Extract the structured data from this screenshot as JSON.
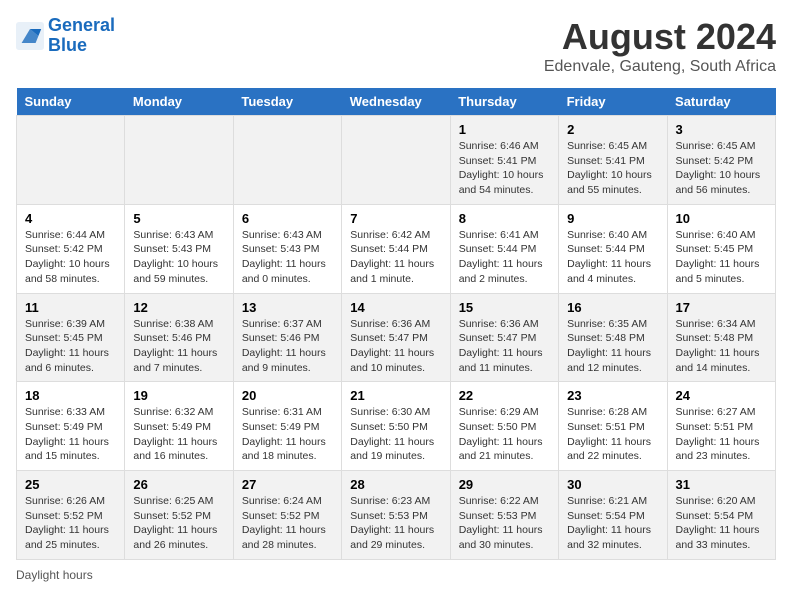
{
  "header": {
    "logo_line1": "General",
    "logo_line2": "Blue",
    "title": "August 2024",
    "subtitle": "Edenvale, Gauteng, South Africa"
  },
  "weekdays": [
    "Sunday",
    "Monday",
    "Tuesday",
    "Wednesday",
    "Thursday",
    "Friday",
    "Saturday"
  ],
  "weeks": [
    [
      {
        "day": "",
        "info": ""
      },
      {
        "day": "",
        "info": ""
      },
      {
        "day": "",
        "info": ""
      },
      {
        "day": "",
        "info": ""
      },
      {
        "day": "1",
        "info": "Sunrise: 6:46 AM\nSunset: 5:41 PM\nDaylight: 10 hours and 54 minutes."
      },
      {
        "day": "2",
        "info": "Sunrise: 6:45 AM\nSunset: 5:41 PM\nDaylight: 10 hours and 55 minutes."
      },
      {
        "day": "3",
        "info": "Sunrise: 6:45 AM\nSunset: 5:42 PM\nDaylight: 10 hours and 56 minutes."
      }
    ],
    [
      {
        "day": "4",
        "info": "Sunrise: 6:44 AM\nSunset: 5:42 PM\nDaylight: 10 hours and 58 minutes."
      },
      {
        "day": "5",
        "info": "Sunrise: 6:43 AM\nSunset: 5:43 PM\nDaylight: 10 hours and 59 minutes."
      },
      {
        "day": "6",
        "info": "Sunrise: 6:43 AM\nSunset: 5:43 PM\nDaylight: 11 hours and 0 minutes."
      },
      {
        "day": "7",
        "info": "Sunrise: 6:42 AM\nSunset: 5:44 PM\nDaylight: 11 hours and 1 minute."
      },
      {
        "day": "8",
        "info": "Sunrise: 6:41 AM\nSunset: 5:44 PM\nDaylight: 11 hours and 2 minutes."
      },
      {
        "day": "9",
        "info": "Sunrise: 6:40 AM\nSunset: 5:44 PM\nDaylight: 11 hours and 4 minutes."
      },
      {
        "day": "10",
        "info": "Sunrise: 6:40 AM\nSunset: 5:45 PM\nDaylight: 11 hours and 5 minutes."
      }
    ],
    [
      {
        "day": "11",
        "info": "Sunrise: 6:39 AM\nSunset: 5:45 PM\nDaylight: 11 hours and 6 minutes."
      },
      {
        "day": "12",
        "info": "Sunrise: 6:38 AM\nSunset: 5:46 PM\nDaylight: 11 hours and 7 minutes."
      },
      {
        "day": "13",
        "info": "Sunrise: 6:37 AM\nSunset: 5:46 PM\nDaylight: 11 hours and 9 minutes."
      },
      {
        "day": "14",
        "info": "Sunrise: 6:36 AM\nSunset: 5:47 PM\nDaylight: 11 hours and 10 minutes."
      },
      {
        "day": "15",
        "info": "Sunrise: 6:36 AM\nSunset: 5:47 PM\nDaylight: 11 hours and 11 minutes."
      },
      {
        "day": "16",
        "info": "Sunrise: 6:35 AM\nSunset: 5:48 PM\nDaylight: 11 hours and 12 minutes."
      },
      {
        "day": "17",
        "info": "Sunrise: 6:34 AM\nSunset: 5:48 PM\nDaylight: 11 hours and 14 minutes."
      }
    ],
    [
      {
        "day": "18",
        "info": "Sunrise: 6:33 AM\nSunset: 5:49 PM\nDaylight: 11 hours and 15 minutes."
      },
      {
        "day": "19",
        "info": "Sunrise: 6:32 AM\nSunset: 5:49 PM\nDaylight: 11 hours and 16 minutes."
      },
      {
        "day": "20",
        "info": "Sunrise: 6:31 AM\nSunset: 5:49 PM\nDaylight: 11 hours and 18 minutes."
      },
      {
        "day": "21",
        "info": "Sunrise: 6:30 AM\nSunset: 5:50 PM\nDaylight: 11 hours and 19 minutes."
      },
      {
        "day": "22",
        "info": "Sunrise: 6:29 AM\nSunset: 5:50 PM\nDaylight: 11 hours and 21 minutes."
      },
      {
        "day": "23",
        "info": "Sunrise: 6:28 AM\nSunset: 5:51 PM\nDaylight: 11 hours and 22 minutes."
      },
      {
        "day": "24",
        "info": "Sunrise: 6:27 AM\nSunset: 5:51 PM\nDaylight: 11 hours and 23 minutes."
      }
    ],
    [
      {
        "day": "25",
        "info": "Sunrise: 6:26 AM\nSunset: 5:52 PM\nDaylight: 11 hours and 25 minutes."
      },
      {
        "day": "26",
        "info": "Sunrise: 6:25 AM\nSunset: 5:52 PM\nDaylight: 11 hours and 26 minutes."
      },
      {
        "day": "27",
        "info": "Sunrise: 6:24 AM\nSunset: 5:52 PM\nDaylight: 11 hours and 28 minutes."
      },
      {
        "day": "28",
        "info": "Sunrise: 6:23 AM\nSunset: 5:53 PM\nDaylight: 11 hours and 29 minutes."
      },
      {
        "day": "29",
        "info": "Sunrise: 6:22 AM\nSunset: 5:53 PM\nDaylight: 11 hours and 30 minutes."
      },
      {
        "day": "30",
        "info": "Sunrise: 6:21 AM\nSunset: 5:54 PM\nDaylight: 11 hours and 32 minutes."
      },
      {
        "day": "31",
        "info": "Sunrise: 6:20 AM\nSunset: 5:54 PM\nDaylight: 11 hours and 33 minutes."
      }
    ]
  ],
  "legend": "Daylight hours"
}
